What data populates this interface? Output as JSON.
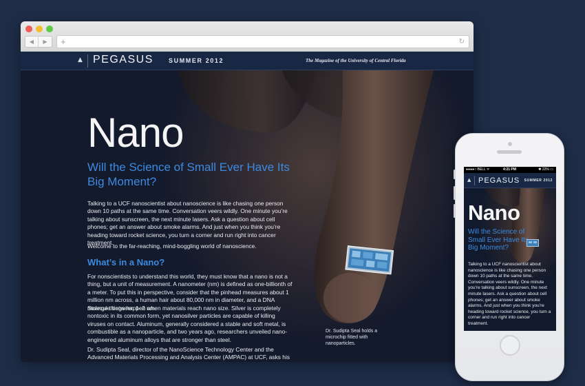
{
  "browser": {
    "nav": {
      "back_icon": "◀",
      "forward_icon": "▶"
    },
    "url_plus": "+",
    "reload_icon": "↻"
  },
  "site": {
    "logo_arrow": "▲",
    "logo": "PEGASUS",
    "issue": "SUMMER 2012",
    "tagline": "The Magazine of the University of Central Florida"
  },
  "article": {
    "headline": "Nano",
    "dek": "Will the Science of Small Ever Have Its Big Moment?",
    "intro": "Talking to a UCF nanoscientist about nanoscience is like chasing one person down 10 paths at the same time. Conversation veers wildly. One minute you’re talking about sunscreen, the next minute lasers. Ask a question about cell phones; get an answer about smoke alarms. And just when you think you’re heading toward rocket science, you turn a corner and run right into cancer treatment.",
    "welcome": "Welcome to the far-reaching, mind-boggling world of nanoscience.",
    "subhead": "What’s in a Nano?",
    "p1": "For nonscientists to understand this world, they must know that a nano is not a thing, but a unit of measurement. A nanometer (nm) is defined as one-billionth of a meter. To put this in perspective, consider that the pinhead measures about 1 million nm across, a human hair about 80,000 nm in diameter, and a DNA molecule between 1–2 nm.",
    "p2": "Strange things happen when materials reach nano size. Silver is completely nontoxic in its common form, yet nanosilver particles are capable of killing viruses on contact. Aluminum, generally considered a stable and soft metal, is combustible as a nanoparticle, and two years ago, researchers unveiled nano-engineered aluminum alloys that are stronger than steel.",
    "p3": "Dr. Sudipta Seal, director of the NanoScience Technology Center and the Advanced Materials Processing and Analysis Center (AMPAC) at UCF, asks his classes, “When is",
    "caption": "Dr. Sudipta Seal holds a microchip fitted with nanoparticles."
  },
  "phone": {
    "carrier": "●●●●○ BELL ᯤ",
    "time": "4:21 PM",
    "battery": "✱ 22% ▭",
    "logo_arrow": "▲",
    "logo": "PEGASUS",
    "issue": "SUMMER 2012",
    "headline": "Nano",
    "dek": "Will the Science of Small Ever Have Its Big Moment?",
    "body": "Talking to a UCF nanoscientist about nanoscience is like chasing one person down 10 paths at the same time. Conversation veers wildly. One minute you’re talking about sunscreen, the next minute lasers. Ask a question about cell phones; get an answer about smoke alarms. And just when you think you’re heading toward rocket science, you turn a corner and run right into cancer treatment."
  }
}
